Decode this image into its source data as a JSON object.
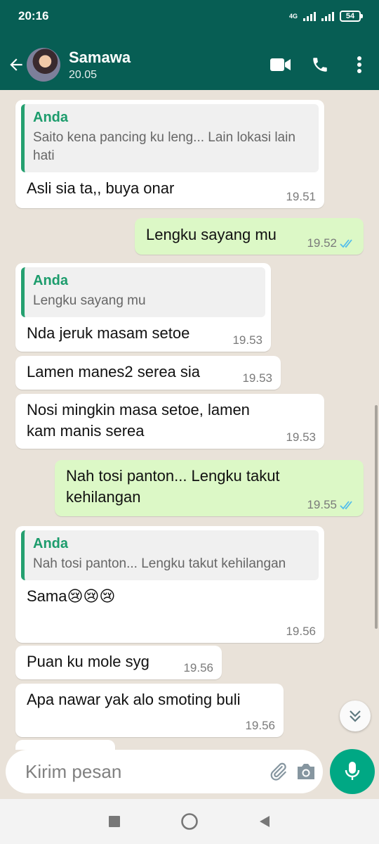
{
  "status": {
    "time": "20:16",
    "network": "4G",
    "battery": "54"
  },
  "header": {
    "contact_name": "Samawa",
    "contact_sub": "20.05"
  },
  "messages": [
    {
      "type": "in",
      "quote_name": "Anda",
      "quote_text": "Saito kena pancing ku leng... Lain lokasi lain hati",
      "text": "Asli sia ta,, buya onar",
      "time": "19.51"
    },
    {
      "type": "out",
      "text": "Lengku sayang mu",
      "time": "19.52",
      "status": "read"
    },
    {
      "type": "in",
      "quote_name": "Anda",
      "quote_text": "Lengku sayang mu",
      "text": "Nda jeruk masam setoe",
      "time": "19.53"
    },
    {
      "type": "in",
      "text": "Lamen manes2 serea sia",
      "time": "19.53"
    },
    {
      "type": "in",
      "text": "Nosi mingkin masa setoe, lamen kam manis serea",
      "time": "19.53"
    },
    {
      "type": "out",
      "text": "Nah tosi panton... Lengku takut kehilangan",
      "time": "19.55",
      "status": "read"
    },
    {
      "type": "in",
      "quote_name": "Anda",
      "quote_text": "Nah tosi panton... Lengku takut kehilangan",
      "text": "Sama😢😢😢",
      "time": "19.56"
    },
    {
      "type": "in",
      "text": "Puan ku mole syg",
      "time": "19.56"
    },
    {
      "type": "in",
      "text": "Apa nawar yak alo smoting buli",
      "time": "19.56"
    }
  ],
  "composer": {
    "placeholder": "Kirim pesan"
  },
  "colors": {
    "header": "#075e54",
    "outgoing_bubble": "#dcf8c6",
    "incoming_bubble": "#ffffff",
    "accent": "#00a884",
    "read_ticks": "#53bdeb"
  },
  "icons": {
    "back": "arrow-left",
    "video": "video-camera",
    "call": "phone",
    "menu": "dots-vertical",
    "emoji": "smiley",
    "attach": "paperclip",
    "camera": "camera",
    "mic": "microphone",
    "scroll": "double-chevron-down"
  }
}
